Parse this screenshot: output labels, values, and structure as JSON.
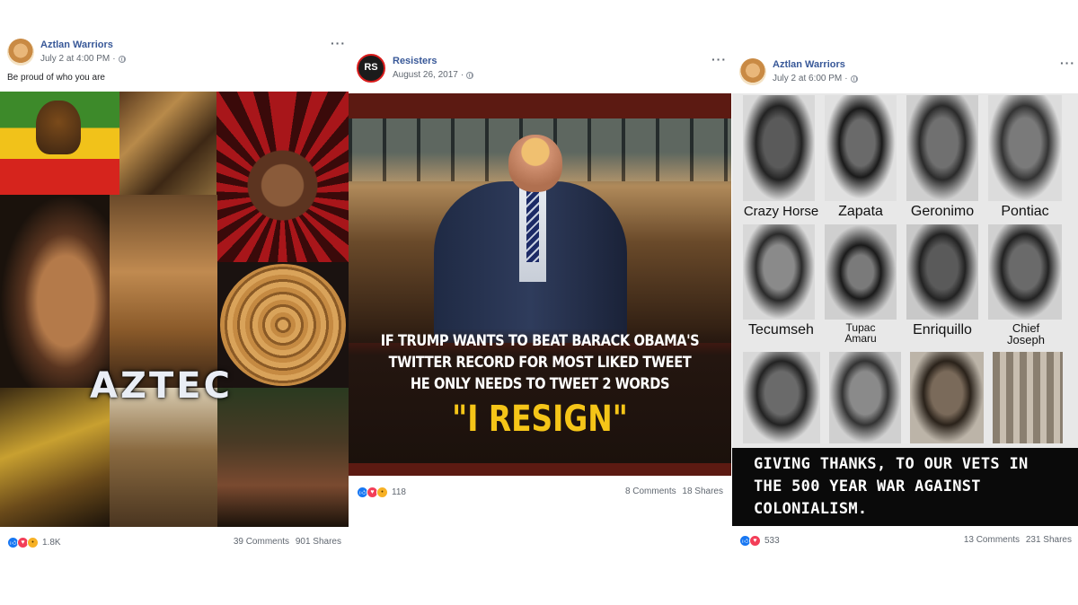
{
  "posts": [
    {
      "page_name": "Aztlan Warriors",
      "timestamp": "July 2 at 4:00 PM",
      "caption": "Be proud of who you are",
      "image_text": "AZTEC",
      "reactions": "1.8K",
      "comments": "39 Comments",
      "shares": "901 Shares"
    },
    {
      "page_name": "Resisters",
      "avatar_text": "RS",
      "timestamp": "August 26, 2017",
      "image_lines": [
        "IF TRUMP WANTS TO BEAT BARACK OBAMA'S",
        "TWITTER RECORD FOR MOST LIKED TWEET",
        "HE ONLY NEEDS TO TWEET 2 WORDS",
        "\"I RESIGN\""
      ],
      "reactions": "118",
      "comments": "8 Comments",
      "shares": "18 Shares"
    },
    {
      "page_name": "Aztlan Warriors",
      "timestamp": "July 2 at 6:00 PM",
      "portrait_labels": [
        [
          "Crazy Horse",
          "Zapata",
          "Geronimo",
          "Pontiac"
        ],
        [
          "Tecumseh",
          "Tupac Amaru",
          "Enriquillo",
          "Chief Joseph"
        ]
      ],
      "image_lines": [
        "GIVING THANKS, TO OUR VETS IN",
        "THE 500 YEAR WAR AGAINST",
        "COLONIALISM."
      ],
      "reactions": "533",
      "comments": "13 Comments",
      "shares": "231 Shares"
    }
  ],
  "colors": {
    "link": "#385898",
    "meta": "#606770",
    "like": "#1877f2",
    "love": "#f33e58",
    "haha": "#f7b125",
    "resign": "#f5c518"
  }
}
